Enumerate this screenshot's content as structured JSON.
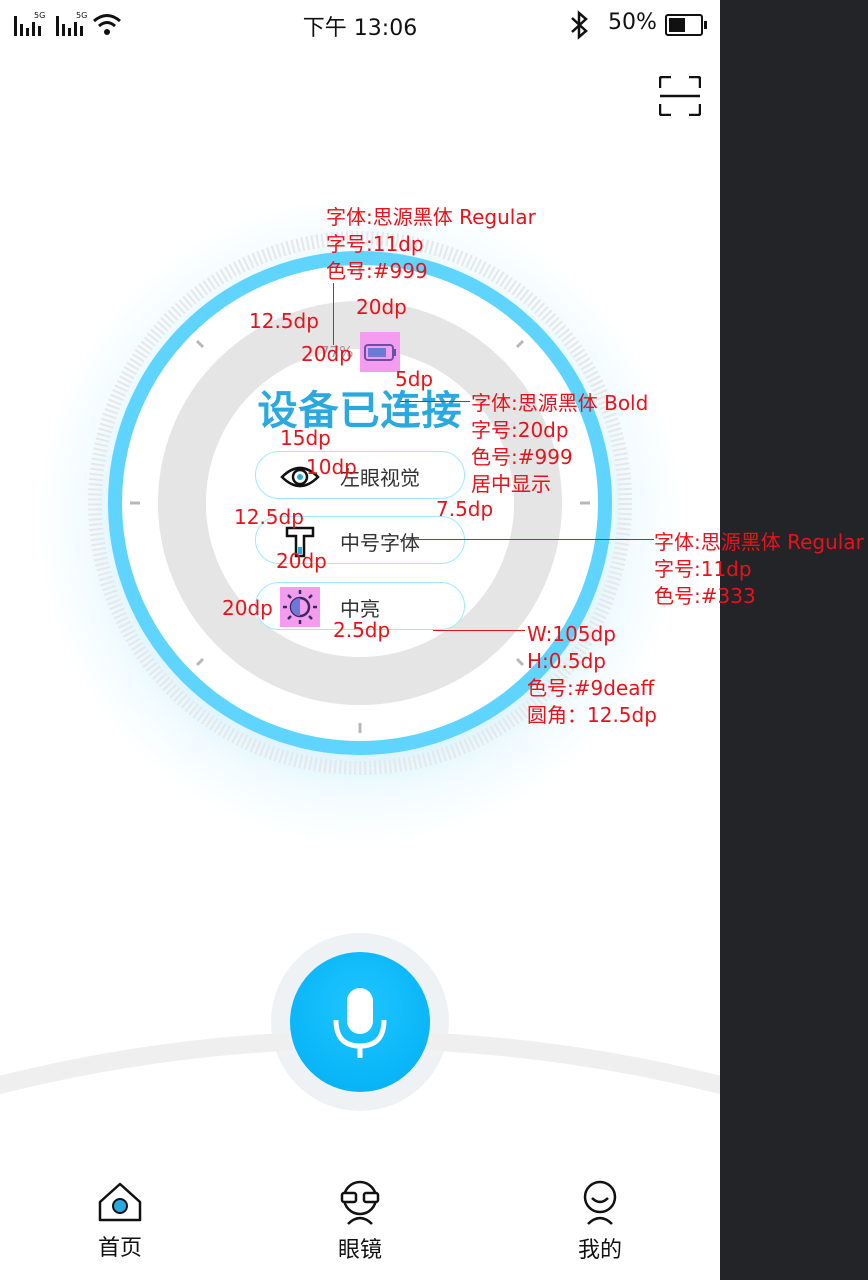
{
  "status_bar": {
    "signal1_label": "5G",
    "signal2_label": "5G",
    "time": "下午 13:06",
    "battery_text": "50%",
    "battery_level": 0.5
  },
  "header": {
    "scan_icon": "scan-icon"
  },
  "device": {
    "battery_percent": "77%",
    "title": "设备已连接",
    "mode_label": "左眼视觉",
    "font_label": "中号字体",
    "brightness_label": "中亮"
  },
  "annotations": {
    "pct_spec": [
      "字体:思源黑体 Regular",
      "字号:11dp",
      "色号:#999"
    ],
    "title_spec": [
      "字体:思源黑体 Bold",
      "字号:20dp",
      "色号:#999",
      "居中显示"
    ],
    "item_spec": [
      "字体:思源黑体 Regular",
      "字号:11dp",
      "色号:#333"
    ],
    "pill_spec": [
      "W:105dp",
      "H:0.5dp",
      "色号:#9deaff",
      "圆角：12.5dp"
    ],
    "dims": {
      "d1": "12.5dp",
      "d2": "20dp",
      "d3": "20dp",
      "d4": "5dp",
      "d5": "15dp",
      "d6": "10dp",
      "d7": "7.5dp",
      "d8": "12.5dp",
      "d9": "20dp",
      "d10": "20dp",
      "d11": "2.5dp"
    }
  },
  "nav": {
    "items": [
      {
        "label": "首页",
        "icon": "home-icon"
      },
      {
        "label": "眼镜",
        "icon": "glasses-icon"
      },
      {
        "label": "我的",
        "icon": "profile-icon"
      }
    ]
  },
  "colors": {
    "ring": "#5fd4ff",
    "title": "#2aa8e0",
    "pill_border": "#9deaff",
    "annotation": "#e8121b",
    "mic": "#00aef5"
  }
}
